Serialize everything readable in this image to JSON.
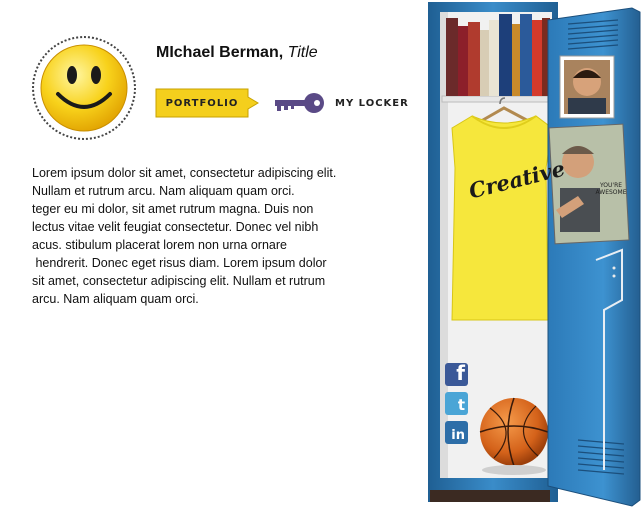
{
  "profile": {
    "name": "MIchael Berman,",
    "title": "Title",
    "avatar_icon": "smiley-face-icon"
  },
  "actions": {
    "portfolio_label": "PORTFOLIO",
    "locker_label": "MY LOCKER",
    "locker_icon": "key-icon"
  },
  "bio": {
    "lines": [
      "Lorem ipsum dolor sit amet, consectetur adipiscing elit.",
      "Nullam et rutrum arcu. Nam aliquam quam orci.",
      "teger eu mi dolor, sit amet rutrum magna. Duis non",
      "lectus vitae velit feugiat consectetur. Donec vel nibh",
      "acus. stibulum placerat lorem non urna ornare",
      " hendrerit. Donec eget risus diam. Lorem ipsum dolor",
      "sit amet, consectetur adipiscing elit. Nullam et rutrum",
      "arcu. Nam aliquam quam orci."
    ]
  },
  "locker": {
    "shirt_text": "Creative",
    "poster_text": "YOU'RE AWESOME",
    "social": {
      "facebook_glyph": "f",
      "twitter_glyph": "t",
      "linkedin_glyph": "in"
    }
  },
  "colors": {
    "accent_yellow": "#f4cf1d",
    "key_purple": "#5a4a86",
    "locker_blue": "#2c7ab8",
    "shirt_yellow": "#f6e73c"
  }
}
